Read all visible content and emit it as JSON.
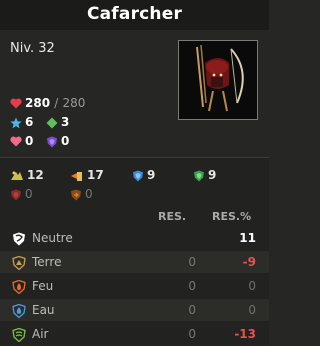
{
  "title": "Cafarcher",
  "level": "Niv. 32",
  "stats": {
    "hp_current": "280",
    "hp_sep": "/",
    "hp_max": "280",
    "ap": "6",
    "mp": "3",
    "heal": "0",
    "shield": "0"
  },
  "secondary": {
    "row1": [
      "12",
      "17",
      "9",
      "9"
    ],
    "row2": [
      "0",
      "0"
    ]
  },
  "columns": {
    "res": "RES.",
    "res_pct": "RES.%"
  },
  "elements": [
    {
      "name": "Neutre",
      "res": "",
      "pct": "11"
    },
    {
      "name": "Terre",
      "res": "0",
      "pct": "-9"
    },
    {
      "name": "Feu",
      "res": "0",
      "pct": "0"
    },
    {
      "name": "Eau",
      "res": "0",
      "pct": "0"
    },
    {
      "name": "Air",
      "res": "0",
      "pct": "-13"
    }
  ],
  "icons": {
    "hp": "heart-icon",
    "ap": "star-icon",
    "mp": "diamond-icon",
    "heal": "pink-heart-icon",
    "shield": "shield-icon"
  },
  "colors": {
    "hp": "#e83a4a",
    "ap": "#4ab3e8",
    "mp": "#5fbf5a",
    "heal": "#f06a8a",
    "shield": "#7a4ad6",
    "negative": "#e4534f"
  }
}
